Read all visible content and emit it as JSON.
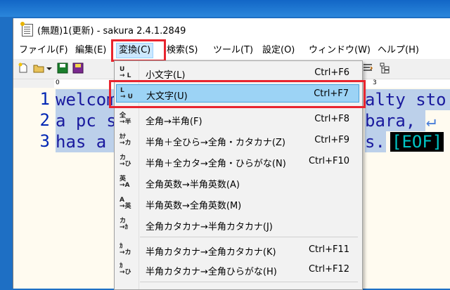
{
  "window": {
    "title": "(無題)1(更新) - sakura 2.4.1.2849"
  },
  "menubar": [
    {
      "label": "ファイル(F)"
    },
    {
      "label": "編集(E)"
    },
    {
      "label": "変換(C)"
    },
    {
      "label": "検索(S)"
    },
    {
      "label": "ツール(T)"
    },
    {
      "label": "設定(O)"
    },
    {
      "label": "ウィンドウ(W)"
    },
    {
      "label": "ヘルプ(H)"
    }
  ],
  "ruler": {
    "mark0": "0",
    "mark3": "3"
  },
  "editor": {
    "line_numbers": [
      "1",
      "2",
      "3"
    ],
    "lines": [
      "welcom",
      "a pc s",
      "has a "
    ],
    "right_fragments": [
      "alty sto",
      "bara, ",
      "s."
    ],
    "linebreak_glyph": "↵",
    "eof_marker": "[EOF]"
  },
  "dropdown": {
    "items": [
      {
        "label": "小文字(L)",
        "shortcut": "Ctrl+F6",
        "icon": "lowercase-icon"
      },
      {
        "label": "大文字(U)",
        "shortcut": "Ctrl+F7",
        "icon": "uppercase-icon"
      },
      {
        "label": "全角→半角(F)",
        "shortcut": "Ctrl+F8",
        "icon": "zen-to-han-icon"
      },
      {
        "label": "半角＋全ひら→全角・カタカナ(Z)",
        "shortcut": "Ctrl+F9",
        "icon": "to-zen-katakana-icon"
      },
      {
        "label": "半角＋全カタ→全角・ひらがな(N)",
        "shortcut": "Ctrl+F10",
        "icon": "to-zen-hiragana-icon"
      },
      {
        "label": "全角英数→半角英数(A)",
        "shortcut": "",
        "icon": "zen-alnum-to-han-icon"
      },
      {
        "label": "半角英数→全角英数(M)",
        "shortcut": "",
        "icon": "han-alnum-to-zen-icon"
      },
      {
        "label": "全角カタカナ→半角カタカナ(J)",
        "shortcut": "",
        "icon": "zen-kata-to-han-icon"
      },
      {
        "label": "半角カタカナ→全角カタカナ(K)",
        "shortcut": "Ctrl+F11",
        "icon": "han-kata-to-zen-kata-icon"
      },
      {
        "label": "半角カタカナ→全角ひらがな(H)",
        "shortcut": "Ctrl+F12",
        "icon": "han-kata-to-zen-hira-icon"
      }
    ]
  }
}
